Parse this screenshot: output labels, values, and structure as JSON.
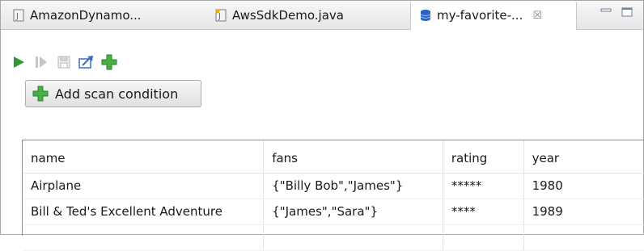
{
  "tabs": [
    {
      "label": "AmazonDynamo...",
      "icon": "java-file-icon",
      "active": false
    },
    {
      "label": "AwsSdkDemo.java",
      "icon": "java-file-icon",
      "active": false
    },
    {
      "label": "my-favorite-...",
      "icon": "database-icon",
      "active": true,
      "close_glyph": "☒"
    }
  ],
  "window_controls": {
    "minimize": "minimize-icon",
    "maximize": "maximize-icon"
  },
  "toolbar": {
    "icons": [
      "run-icon",
      "step-icon",
      "save-icon",
      "export-icon",
      "add-icon"
    ]
  },
  "scan": {
    "add_condition_label": "Add scan condition"
  },
  "table": {
    "columns": [
      "name",
      "fans",
      "rating",
      "year"
    ],
    "rows": [
      [
        "Airplane",
        "{\"Billy Bob\",\"James\"}",
        "*****",
        "1980"
      ],
      [
        "Bill & Ted's Excellent Adventure",
        "{\"James\",\"Sara\"}",
        "****",
        "1989"
      ]
    ]
  },
  "colors": {
    "green": "#3aa93a",
    "accent": "#3c6ec8"
  }
}
